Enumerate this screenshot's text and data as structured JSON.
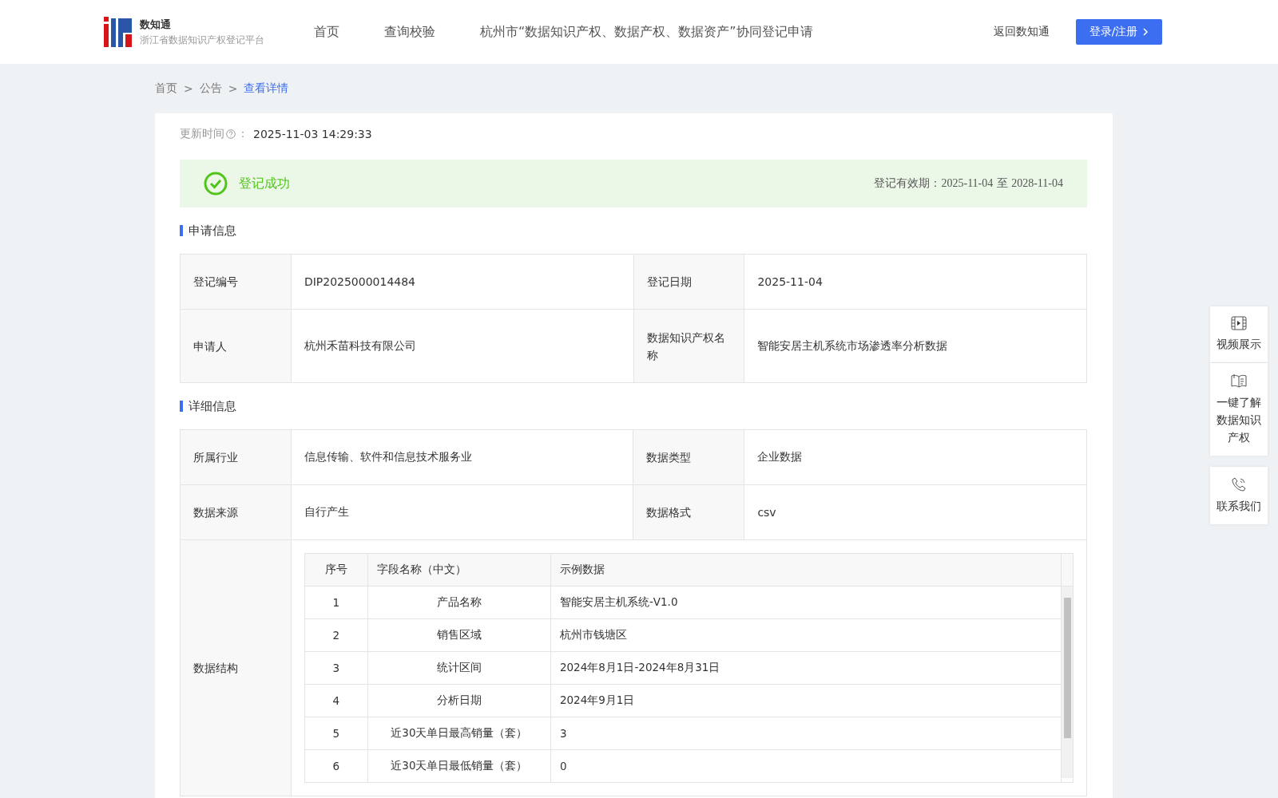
{
  "header": {
    "logo_title": "数知通",
    "logo_subtitle": "浙江省数据知识产权登记平台",
    "nav": [
      {
        "label": "首页",
        "selected": false
      },
      {
        "label": "查询校验",
        "selected": false
      },
      {
        "label": "杭州市“数据知识产权、数据产权、数据资产”协同登记申请",
        "selected": false
      }
    ],
    "back_link": "返回数知通",
    "login_button": "登录/注册"
  },
  "breadcrumb": [
    {
      "label": "首页",
      "selected": false
    },
    {
      "label": "公告",
      "selected": false
    },
    {
      "label": "查看详情",
      "selected": true
    }
  ],
  "breadcrumb_separator": ">",
  "update": {
    "label": "更新时间",
    "colon": "：",
    "value": "2025-11-03 14:29:33"
  },
  "status": {
    "text": "登记成功",
    "validity_label": "登记有效期：",
    "validity_from": "2025-11-04",
    "validity_sep": "至",
    "validity_to": "2028-11-04"
  },
  "application_info": {
    "title": "申请信息",
    "rows": [
      {
        "label_1": "登记编号",
        "value_1": "DIP2025000014484",
        "label_2": "登记日期",
        "value_2": "2025-11-04"
      },
      {
        "label_1": "申请人",
        "value_1": "杭州禾苗科技有限公司",
        "label_2": "数据知识产权名称",
        "value_2": "智能安居主机系统市场渗透率分析数据"
      }
    ]
  },
  "detail_info": {
    "title": "详细信息",
    "rows": [
      {
        "label_1": "所属行业",
        "value_1": "信息传输、软件和信息技术服务业",
        "label_2": "数据类型",
        "value_2": "企业数据"
      },
      {
        "label_1": "数据来源",
        "value_1": "自行产生",
        "label_2": "数据格式",
        "value_2": "csv"
      }
    ],
    "structure_label": "数据结构",
    "structure": {
      "columns": [
        "序号",
        "字段名称（中文）",
        "示例数据"
      ],
      "rows": [
        {
          "index": "1",
          "field": "产品名称",
          "example": "智能安居主机系统-V1.0"
        },
        {
          "index": "2",
          "field": "销售区域",
          "example": "杭州市钱塘区"
        },
        {
          "index": "3",
          "field": "统计区间",
          "example": "2024年8月1日-2024年8月31日"
        },
        {
          "index": "4",
          "field": "分析日期",
          "example": "2024年9月1日"
        },
        {
          "index": "5",
          "field": "近30天单日最高销量（套）",
          "example": "3"
        },
        {
          "index": "6",
          "field": "近30天单日最低销量（套）",
          "example": "0"
        }
      ]
    }
  },
  "side_panel": [
    {
      "kind": "video",
      "label": "视频展示"
    },
    {
      "kind": "book",
      "label": "一键了解数据知识产权"
    },
    {
      "kind": "phone",
      "label": "联系我们"
    }
  ]
}
